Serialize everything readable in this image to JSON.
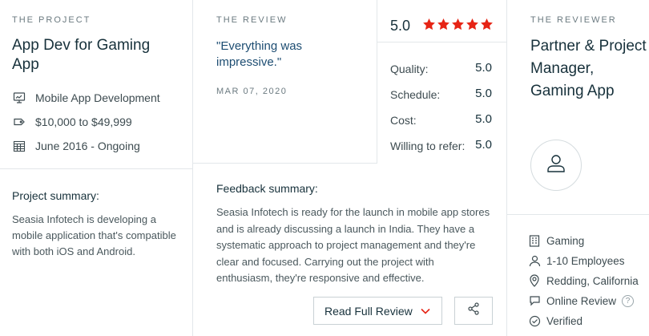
{
  "project": {
    "eyebrow": "THE PROJECT",
    "title": "App Dev for Gaming App",
    "meta": [
      {
        "icon": "monitor-icon",
        "text": "Mobile App Development"
      },
      {
        "icon": "price-tag-icon",
        "text": "$10,000 to $49,999"
      },
      {
        "icon": "calendar-icon",
        "text": "June 2016 - Ongoing"
      }
    ],
    "summary_label": "Project summary:",
    "summary_text": "Seasia Infotech is developing a mobile application that's compatible with both iOS and Android."
  },
  "review": {
    "eyebrow": "THE REVIEW",
    "quote": "\"Everything was impressive.\"",
    "date": "MAR 07, 2020",
    "overall": "5.0",
    "stars": 5,
    "star_color": "#e62415",
    "scores": [
      {
        "label": "Quality:",
        "value": "5.0"
      },
      {
        "label": "Schedule:",
        "value": "5.0"
      },
      {
        "label": "Cost:",
        "value": "5.0"
      },
      {
        "label": "Willing to refer:",
        "value": "5.0"
      }
    ],
    "feedback_label": "Feedback summary:",
    "feedback_text": "Seasia Infotech is ready for the launch in mobile app stores and is already discussing a launch in India. They have a systematic approach to project management and they're clear and focused. Carrying out the project with enthusiasm, they're responsive and effective.",
    "read_full_label": "Read Full Review",
    "accent_color": "#e62415"
  },
  "reviewer": {
    "eyebrow": "THE REVIEWER",
    "name": "Partner & Project Manager, Gaming App",
    "details": [
      {
        "icon": "building-icon",
        "text": "Gaming"
      },
      {
        "icon": "person-icon",
        "text": "1-10 Employees"
      },
      {
        "icon": "location-pin-icon",
        "text": "Redding, California"
      },
      {
        "icon": "chat-bubble-icon",
        "text": "Online Review"
      },
      {
        "icon": "check-circle-icon",
        "text": "Verified"
      }
    ],
    "help_glyph": "?"
  }
}
